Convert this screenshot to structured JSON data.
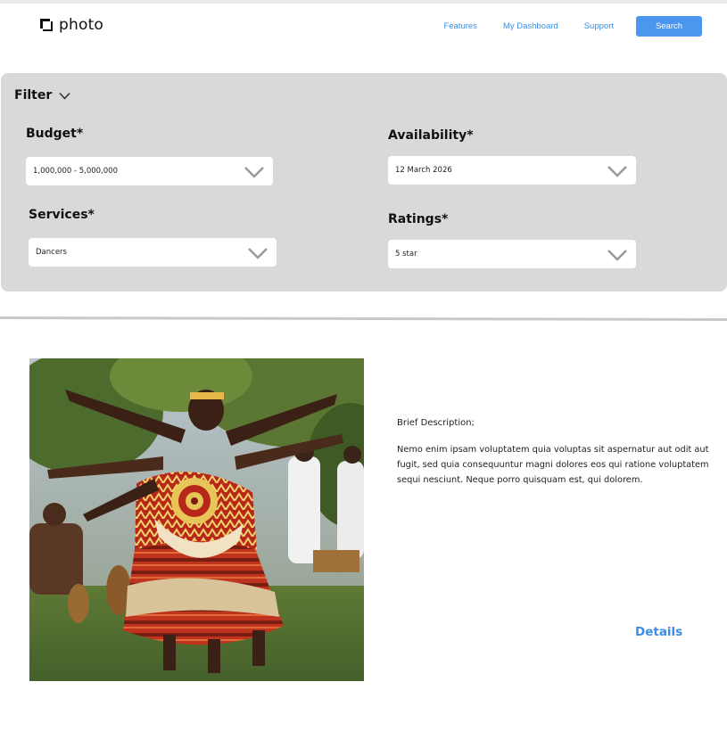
{
  "header": {
    "logo_text": "photo",
    "nav": {
      "features": "Features",
      "dashboard": "My Dashboard",
      "support": "Support"
    },
    "search_label": "Search"
  },
  "filter": {
    "title": "Filter",
    "budget": {
      "label": "Budget*",
      "value": "1,000,000 - 5,000,000"
    },
    "availability": {
      "label": "Availability*",
      "value": "12 March 2026"
    },
    "services": {
      "label": "Services*",
      "value": "Dancers"
    },
    "ratings": {
      "label": "Ratings*",
      "value": "5 star"
    }
  },
  "listing": {
    "description_title": "Brief Description;",
    "description_body": "Nemo enim ipsam voluptatem quia voluptas sit aspernatur aut odit aut fugit, sed quia consequuntur magni dolores eos qui ratione voluptatem sequi nesciunt. Neque porro quisquam est, qui dolorem.",
    "details_label": "Details"
  },
  "colors": {
    "accent": "#4a97ef",
    "link": "#3a8ee6",
    "panel": "#d9d9d9"
  }
}
